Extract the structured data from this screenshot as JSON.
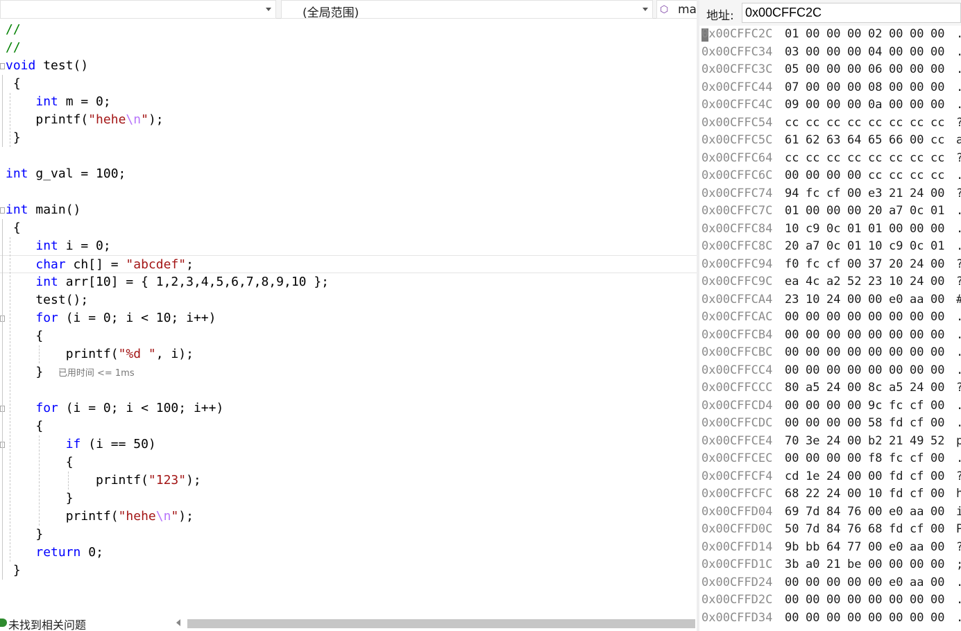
{
  "nav": {
    "project_combo": "",
    "scope_combo": "(全局范围)",
    "func_combo": "ma"
  },
  "code": {
    "lines": [
      [
        {
          "t": "//",
          "c": "cm"
        }
      ],
      [
        {
          "t": "//",
          "c": "cm"
        }
      ],
      [
        {
          "t": "void",
          "c": "kw"
        },
        {
          "t": " test()",
          "c": ""
        }
      ],
      [
        {
          "t": " {",
          "c": ""
        }
      ],
      [
        {
          "t": "    ",
          "c": ""
        },
        {
          "t": "int",
          "c": "kw"
        },
        {
          "t": " m = 0;",
          "c": ""
        }
      ],
      [
        {
          "t": "    printf(",
          "c": ""
        },
        {
          "t": "\"hehe",
          "c": "str"
        },
        {
          "t": "\\n",
          "c": "esc"
        },
        {
          "t": "\"",
          "c": "str"
        },
        {
          "t": ");",
          "c": ""
        }
      ],
      [
        {
          "t": " }",
          "c": ""
        }
      ],
      [],
      [
        {
          "t": "int",
          "c": "kw"
        },
        {
          "t": " g_val = 100;",
          "c": ""
        }
      ],
      [],
      [
        {
          "t": "int",
          "c": "kw"
        },
        {
          "t": " main()",
          "c": ""
        }
      ],
      [
        {
          "t": " {",
          "c": ""
        }
      ],
      [
        {
          "t": "    ",
          "c": ""
        },
        {
          "t": "int",
          "c": "kw"
        },
        {
          "t": " i = 0;",
          "c": ""
        }
      ],
      [
        {
          "t": "    ",
          "c": ""
        },
        {
          "t": "char",
          "c": "kw"
        },
        {
          "t": " ch[] = ",
          "c": ""
        },
        {
          "t": "\"abcdef\"",
          "c": "str"
        },
        {
          "t": ";",
          "c": ""
        }
      ],
      [
        {
          "t": "    ",
          "c": ""
        },
        {
          "t": "int",
          "c": "kw"
        },
        {
          "t": " arr[10] = { 1,2,3,4,5,6,7,8,9,10 };",
          "c": ""
        }
      ],
      [
        {
          "t": "    test();",
          "c": ""
        }
      ],
      [
        {
          "t": "    ",
          "c": ""
        },
        {
          "t": "for",
          "c": "kw"
        },
        {
          "t": " (i = 0; i < 10; i++)",
          "c": ""
        }
      ],
      [
        {
          "t": "    {",
          "c": ""
        }
      ],
      [
        {
          "t": "        printf(",
          "c": ""
        },
        {
          "t": "\"%d \"",
          "c": "str"
        },
        {
          "t": ", i);",
          "c": ""
        }
      ],
      [
        {
          "t": "    }  ",
          "c": ""
        },
        {
          "t": "已用时间 <= 1ms",
          "c": "hint"
        }
      ],
      [],
      [
        {
          "t": "    ",
          "c": ""
        },
        {
          "t": "for",
          "c": "kw"
        },
        {
          "t": " (i = 0; i < 100; i++)",
          "c": ""
        }
      ],
      [
        {
          "t": "    {",
          "c": ""
        }
      ],
      [
        {
          "t": "        ",
          "c": ""
        },
        {
          "t": "if",
          "c": "kw"
        },
        {
          "t": " (i == 50)",
          "c": ""
        }
      ],
      [
        {
          "t": "        {",
          "c": ""
        }
      ],
      [
        {
          "t": "            printf(",
          "c": ""
        },
        {
          "t": "\"123\"",
          "c": "str"
        },
        {
          "t": ");",
          "c": ""
        }
      ],
      [
        {
          "t": "        }",
          "c": ""
        }
      ],
      [
        {
          "t": "        printf(",
          "c": ""
        },
        {
          "t": "\"hehe",
          "c": "str"
        },
        {
          "t": "\\n",
          "c": "esc"
        },
        {
          "t": "\"",
          "c": "str"
        },
        {
          "t": ");",
          "c": ""
        }
      ],
      [
        {
          "t": "    }",
          "c": ""
        }
      ],
      [
        {
          "t": "    ",
          "c": ""
        },
        {
          "t": "return",
          "c": "kw"
        },
        {
          "t": " 0;",
          "c": ""
        }
      ],
      [
        {
          "t": " }",
          "c": ""
        }
      ]
    ]
  },
  "status": {
    "text": "未找到相关问题"
  },
  "memory": {
    "label": "地址:",
    "address": "0x00CFFC2C",
    "rows": [
      {
        "addr": "0x00CFFC2C",
        "bytes": [
          "01",
          "00",
          "00",
          "00",
          "02",
          "00",
          "00",
          "00"
        ],
        "ascii": "."
      },
      {
        "addr": "0x00CFFC34",
        "bytes": [
          "03",
          "00",
          "00",
          "00",
          "04",
          "00",
          "00",
          "00"
        ],
        "ascii": "."
      },
      {
        "addr": "0x00CFFC3C",
        "bytes": [
          "05",
          "00",
          "00",
          "00",
          "06",
          "00",
          "00",
          "00"
        ],
        "ascii": "."
      },
      {
        "addr": "0x00CFFC44",
        "bytes": [
          "07",
          "00",
          "00",
          "00",
          "08",
          "00",
          "00",
          "00"
        ],
        "ascii": "."
      },
      {
        "addr": "0x00CFFC4C",
        "bytes": [
          "09",
          "00",
          "00",
          "00",
          "0a",
          "00",
          "00",
          "00"
        ],
        "ascii": "."
      },
      {
        "addr": "0x00CFFC54",
        "bytes": [
          "cc",
          "cc",
          "cc",
          "cc",
          "cc",
          "cc",
          "cc",
          "cc"
        ],
        "ascii": "?"
      },
      {
        "addr": "0x00CFFC5C",
        "bytes": [
          "61",
          "62",
          "63",
          "64",
          "65",
          "66",
          "00",
          "cc"
        ],
        "ascii": "a"
      },
      {
        "addr": "0x00CFFC64",
        "bytes": [
          "cc",
          "cc",
          "cc",
          "cc",
          "cc",
          "cc",
          "cc",
          "cc"
        ],
        "ascii": "?"
      },
      {
        "addr": "0x00CFFC6C",
        "bytes": [
          "00",
          "00",
          "00",
          "00",
          "cc",
          "cc",
          "cc",
          "cc"
        ],
        "ascii": "."
      },
      {
        "addr": "0x00CFFC74",
        "bytes": [
          "94",
          "fc",
          "cf",
          "00",
          "e3",
          "21",
          "24",
          "00"
        ],
        "ascii": "?"
      },
      {
        "addr": "0x00CFFC7C",
        "bytes": [
          "01",
          "00",
          "00",
          "00",
          "20",
          "a7",
          "0c",
          "01"
        ],
        "ascii": "."
      },
      {
        "addr": "0x00CFFC84",
        "bytes": [
          "10",
          "c9",
          "0c",
          "01",
          "01",
          "00",
          "00",
          "00"
        ],
        "ascii": "."
      },
      {
        "addr": "0x00CFFC8C",
        "bytes": [
          "20",
          "a7",
          "0c",
          "01",
          "10",
          "c9",
          "0c",
          "01"
        ],
        "ascii": "."
      },
      {
        "addr": "0x00CFFC94",
        "bytes": [
          "f0",
          "fc",
          "cf",
          "00",
          "37",
          "20",
          "24",
          "00"
        ],
        "ascii": "?"
      },
      {
        "addr": "0x00CFFC9C",
        "bytes": [
          "ea",
          "4c",
          "a2",
          "52",
          "23",
          "10",
          "24",
          "00"
        ],
        "ascii": "?"
      },
      {
        "addr": "0x00CFFCA4",
        "bytes": [
          "23",
          "10",
          "24",
          "00",
          "00",
          "e0",
          "aa",
          "00"
        ],
        "ascii": "#"
      },
      {
        "addr": "0x00CFFCAC",
        "bytes": [
          "00",
          "00",
          "00",
          "00",
          "00",
          "00",
          "00",
          "00"
        ],
        "ascii": "."
      },
      {
        "addr": "0x00CFFCB4",
        "bytes": [
          "00",
          "00",
          "00",
          "00",
          "00",
          "00",
          "00",
          "00"
        ],
        "ascii": "."
      },
      {
        "addr": "0x00CFFCBC",
        "bytes": [
          "00",
          "00",
          "00",
          "00",
          "00",
          "00",
          "00",
          "00"
        ],
        "ascii": "."
      },
      {
        "addr": "0x00CFFCC4",
        "bytes": [
          "00",
          "00",
          "00",
          "00",
          "00",
          "00",
          "00",
          "00"
        ],
        "ascii": "."
      },
      {
        "addr": "0x00CFFCCC",
        "bytes": [
          "80",
          "a5",
          "24",
          "00",
          "8c",
          "a5",
          "24",
          "00"
        ],
        "ascii": "?"
      },
      {
        "addr": "0x00CFFCD4",
        "bytes": [
          "00",
          "00",
          "00",
          "00",
          "9c",
          "fc",
          "cf",
          "00"
        ],
        "ascii": "."
      },
      {
        "addr": "0x00CFFCDC",
        "bytes": [
          "00",
          "00",
          "00",
          "00",
          "58",
          "fd",
          "cf",
          "00"
        ],
        "ascii": "."
      },
      {
        "addr": "0x00CFFCE4",
        "bytes": [
          "70",
          "3e",
          "24",
          "00",
          "b2",
          "21",
          "49",
          "52"
        ],
        "ascii": "p"
      },
      {
        "addr": "0x00CFFCEC",
        "bytes": [
          "00",
          "00",
          "00",
          "00",
          "f8",
          "fc",
          "cf",
          "00"
        ],
        "ascii": "."
      },
      {
        "addr": "0x00CFFCF4",
        "bytes": [
          "cd",
          "1e",
          "24",
          "00",
          "00",
          "fd",
          "cf",
          "00"
        ],
        "ascii": "?"
      },
      {
        "addr": "0x00CFFCFC",
        "bytes": [
          "68",
          "22",
          "24",
          "00",
          "10",
          "fd",
          "cf",
          "00"
        ],
        "ascii": "h"
      },
      {
        "addr": "0x00CFFD04",
        "bytes": [
          "69",
          "7d",
          "84",
          "76",
          "00",
          "e0",
          "aa",
          "00"
        ],
        "ascii": "i"
      },
      {
        "addr": "0x00CFFD0C",
        "bytes": [
          "50",
          "7d",
          "84",
          "76",
          "68",
          "fd",
          "cf",
          "00"
        ],
        "ascii": "P"
      },
      {
        "addr": "0x00CFFD14",
        "bytes": [
          "9b",
          "bb",
          "64",
          "77",
          "00",
          "e0",
          "aa",
          "00"
        ],
        "ascii": "?"
      },
      {
        "addr": "0x00CFFD1C",
        "bytes": [
          "3b",
          "a0",
          "21",
          "be",
          "00",
          "00",
          "00",
          "00"
        ],
        "ascii": ";"
      },
      {
        "addr": "0x00CFFD24",
        "bytes": [
          "00",
          "00",
          "00",
          "00",
          "00",
          "e0",
          "aa",
          "00"
        ],
        "ascii": "."
      },
      {
        "addr": "0x00CFFD2C",
        "bytes": [
          "00",
          "00",
          "00",
          "00",
          "00",
          "00",
          "00",
          "00"
        ],
        "ascii": "."
      },
      {
        "addr": "0x00CFFD34",
        "bytes": [
          "00",
          "00",
          "00",
          "00",
          "00",
          "00",
          "00",
          "00"
        ],
        "ascii": "."
      }
    ]
  }
}
